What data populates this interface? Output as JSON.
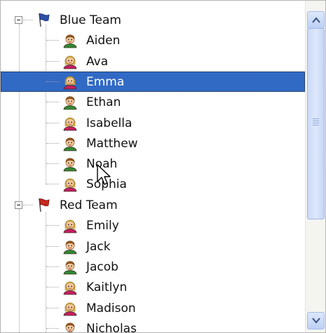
{
  "tree": {
    "groups": [
      {
        "label": "Blue Team",
        "flag_color": "#2c4fa8",
        "icon": "blue-flag-icon",
        "members": [
          {
            "name": "Aiden",
            "gender": "boy"
          },
          {
            "name": "Ava",
            "gender": "girl"
          },
          {
            "name": "Emma",
            "gender": "girl",
            "selected": true
          },
          {
            "name": "Ethan",
            "gender": "boy"
          },
          {
            "name": "Isabella",
            "gender": "girl"
          },
          {
            "name": "Matthew",
            "gender": "boy"
          },
          {
            "name": "Noah",
            "gender": "boy"
          },
          {
            "name": "Sophia",
            "gender": "girl"
          }
        ]
      },
      {
        "label": "Red Team",
        "flag_color": "#c8281e",
        "icon": "red-flag-icon",
        "members": [
          {
            "name": "Emily",
            "gender": "girl"
          },
          {
            "name": "Jack",
            "gender": "boy"
          },
          {
            "name": "Jacob",
            "gender": "boy"
          },
          {
            "name": "Kaitlyn",
            "gender": "girl"
          },
          {
            "name": "Madison",
            "gender": "girl"
          },
          {
            "name": "Nicholas",
            "gender": "boy"
          }
        ]
      }
    ]
  },
  "colors": {
    "selection": "#316ac5",
    "boy_shirt": "#2f8a33",
    "girl_shirt": "#c81e63",
    "boy_hair": "#9a5a1c",
    "girl_hair": "#e8c44a"
  }
}
